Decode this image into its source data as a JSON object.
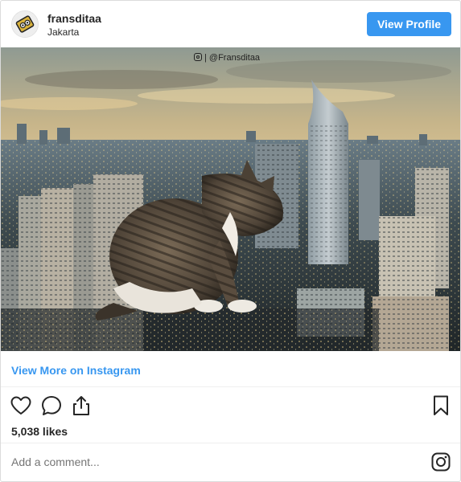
{
  "header": {
    "username": "fransditaa",
    "location": "Jakarta",
    "view_profile_label": "View Profile"
  },
  "photo": {
    "watermark": "| @Fransditaa"
  },
  "view_more_label": "View More on Instagram",
  "likes": "5,038 likes",
  "comment_placeholder": "Add a comment...",
  "colors": {
    "accent": "#3897f0",
    "border": "#dbdbdb"
  },
  "icons": [
    "heart-icon",
    "comment-icon",
    "share-icon",
    "bookmark-icon",
    "instagram-icon"
  ]
}
